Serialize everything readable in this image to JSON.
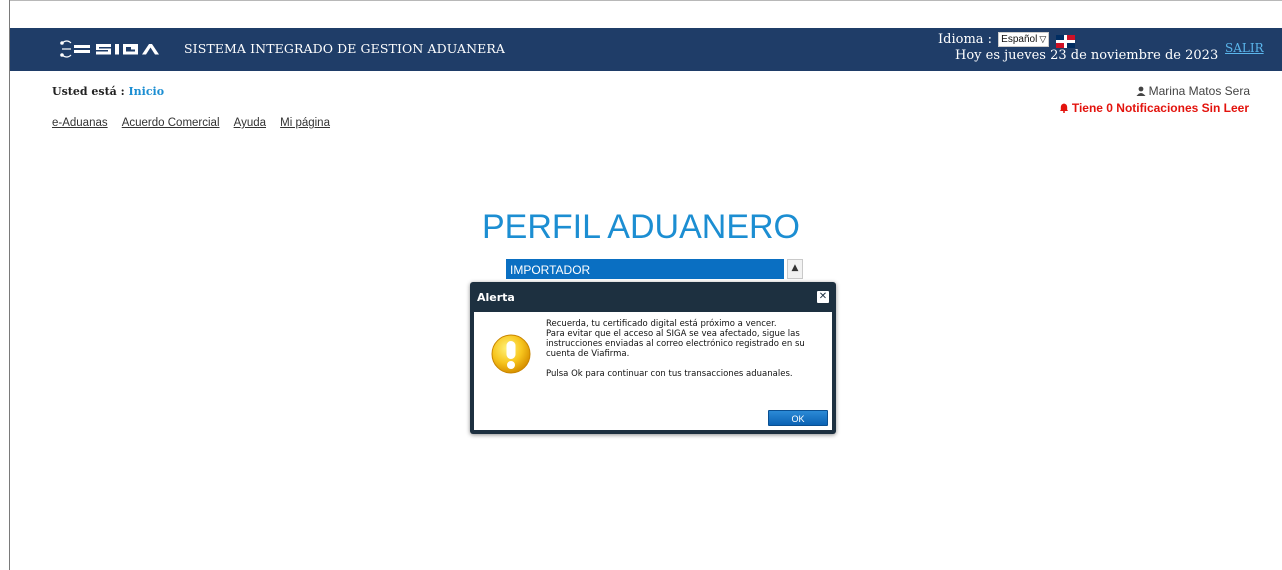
{
  "header": {
    "app_title": "SISTEMA INTEGRADO DE GESTION ADUANERA",
    "language_label": "Idioma :",
    "language_value": "Español",
    "date_text": "Hoy es jueves 23 de noviembre de 2023",
    "logout_label": "SALIR",
    "bar_color": "#1f3d68"
  },
  "breadcrumb": {
    "prefix": "Usted está :",
    "current": "Inicio"
  },
  "nav": {
    "items": [
      "e-Aduanas",
      "Acuerdo Comercial",
      "Ayuda",
      "Mi página"
    ]
  },
  "user": {
    "name": "Marina Matos Sera",
    "notifications_text": "Tiene 0 Notificaciones Sin Leer"
  },
  "profile": {
    "title": "PERFIL ADUANERO",
    "selected_option": "IMPORTADOR"
  },
  "dialog": {
    "title": "Alerta",
    "lines": [
      "Recuerda, tu certificado digital está próximo a vencer.",
      "Para evitar que el acceso al SIGA se vea afectado, sigue las instrucciones enviadas al correo electrónico registrado en su cuenta de Viafirma.",
      "Pulsa Ok para continuar con tus transacciones aduanales."
    ],
    "ok_label": "OK"
  },
  "colors": {
    "accent_blue": "#1c8ed2",
    "alert_red": "#e3130d",
    "dialog_frame": "#1d3040"
  }
}
